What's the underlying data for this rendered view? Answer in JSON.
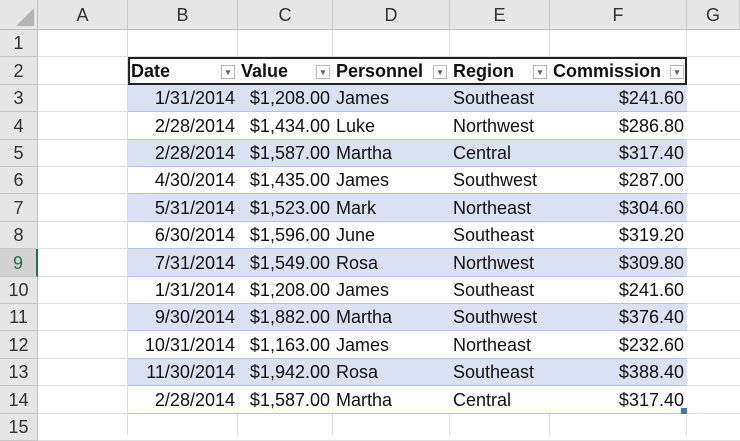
{
  "columns": [
    "A",
    "B",
    "C",
    "D",
    "E",
    "F",
    "G"
  ],
  "rows": [
    "1",
    "2",
    "3",
    "4",
    "5",
    "6",
    "7",
    "8",
    "9",
    "10",
    "11",
    "12",
    "13",
    "14",
    "15"
  ],
  "selected_row": "9",
  "table": {
    "headers": [
      "Date",
      "Value",
      "Personnel",
      "Region",
      "Commission"
    ],
    "data": [
      [
        "1/31/2014",
        "$1,208.00",
        "James",
        "Southeast",
        "$241.60"
      ],
      [
        "2/28/2014",
        "$1,434.00",
        "Luke",
        "Northwest",
        "$286.80"
      ],
      [
        "2/28/2014",
        "$1,587.00",
        "Martha",
        "Central",
        "$317.40"
      ],
      [
        "4/30/2014",
        "$1,435.00",
        "James",
        "Southwest",
        "$287.00"
      ],
      [
        "5/31/2014",
        "$1,523.00",
        "Mark",
        "Northeast",
        "$304.60"
      ],
      [
        "6/30/2014",
        "$1,596.00",
        "June",
        "Southeast",
        "$319.20"
      ],
      [
        "7/31/2014",
        "$1,549.00",
        "Rosa",
        "Northwest",
        "$309.80"
      ],
      [
        "1/31/2014",
        "$1,208.00",
        "James",
        "Southeast",
        "$241.60"
      ],
      [
        "9/30/2014",
        "$1,882.00",
        "Martha",
        "Southwest",
        "$376.40"
      ],
      [
        "10/31/2014",
        "$1,163.00",
        "James",
        "Northeast",
        "$232.60"
      ],
      [
        "11/30/2014",
        "$1,942.00",
        "Rosa",
        "Southeast",
        "$388.40"
      ],
      [
        "2/28/2014",
        "$1,587.00",
        "Martha",
        "Central",
        "$317.40"
      ]
    ]
  },
  "colors": {
    "band": "#d9e1f2",
    "row_border": "#b4c6e7",
    "header_border": "#222222",
    "selection": "#217346"
  }
}
